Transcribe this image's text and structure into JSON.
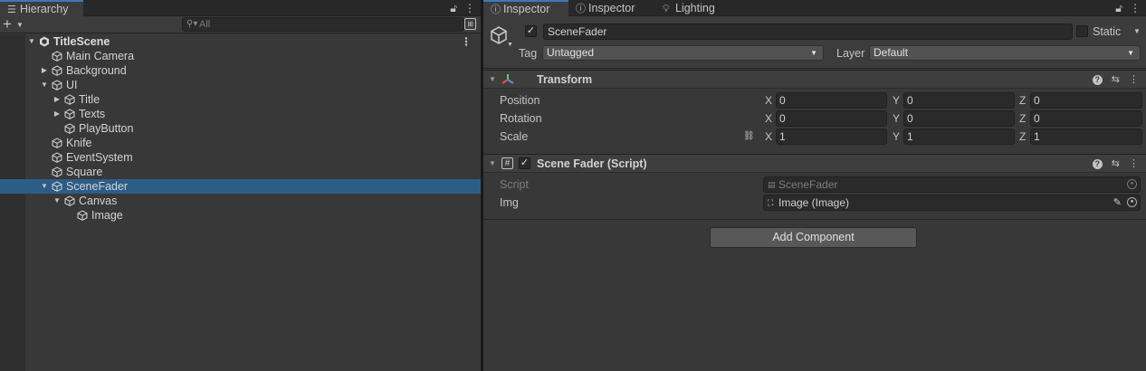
{
  "hierarchy": {
    "tab_label": "Hierarchy",
    "search_placeholder": "All",
    "items": [
      {
        "label": "TitleScene",
        "depth": 0,
        "arrow": "down",
        "type": "scene"
      },
      {
        "label": "Main Camera",
        "depth": 1,
        "arrow": "none",
        "type": "object"
      },
      {
        "label": "Background",
        "depth": 1,
        "arrow": "right",
        "type": "object"
      },
      {
        "label": "UI",
        "depth": 1,
        "arrow": "down",
        "type": "object"
      },
      {
        "label": "Title",
        "depth": 2,
        "arrow": "right",
        "type": "object"
      },
      {
        "label": "Texts",
        "depth": 2,
        "arrow": "right",
        "type": "object"
      },
      {
        "label": "PlayButton",
        "depth": 2,
        "arrow": "none",
        "type": "object"
      },
      {
        "label": "Knife",
        "depth": 1,
        "arrow": "none",
        "type": "object"
      },
      {
        "label": "EventSystem",
        "depth": 1,
        "arrow": "none",
        "type": "object"
      },
      {
        "label": "Square",
        "depth": 1,
        "arrow": "none",
        "type": "object"
      },
      {
        "label": "SceneFader",
        "depth": 1,
        "arrow": "down",
        "type": "object",
        "selected": true
      },
      {
        "label": "Canvas",
        "depth": 2,
        "arrow": "down",
        "type": "object"
      },
      {
        "label": "Image",
        "depth": 3,
        "arrow": "none",
        "type": "object"
      }
    ]
  },
  "inspector": {
    "tabs": [
      {
        "label": "Inspector",
        "icon": "info-icon",
        "active": true
      },
      {
        "label": "Inspector",
        "icon": "info-icon",
        "active": false
      },
      {
        "label": "Lighting",
        "icon": "bulb-icon",
        "active": false
      }
    ],
    "object_name": "SceneFader",
    "static_label": "Static",
    "tag_label": "Tag",
    "tag_value": "Untagged",
    "layer_label": "Layer",
    "layer_value": "Default",
    "transform": {
      "title": "Transform",
      "rows": [
        {
          "label": "Position",
          "x": "0",
          "y": "0",
          "z": "0"
        },
        {
          "label": "Rotation",
          "x": "0",
          "y": "0",
          "z": "0"
        },
        {
          "label": "Scale",
          "x": "1",
          "y": "1",
          "z": "1"
        }
      ],
      "axis_x": "X",
      "axis_y": "Y",
      "axis_z": "Z"
    },
    "script_component": {
      "title": "Scene Fader (Script)",
      "script_label": "Script",
      "script_value": "SceneFader",
      "img_label": "Img",
      "img_value": "Image (Image)"
    },
    "add_component_label": "Add Component"
  },
  "colors": {
    "selection": "#2c5d87",
    "panel_bg": "#383838",
    "tab_accent": "#3a79bb"
  }
}
